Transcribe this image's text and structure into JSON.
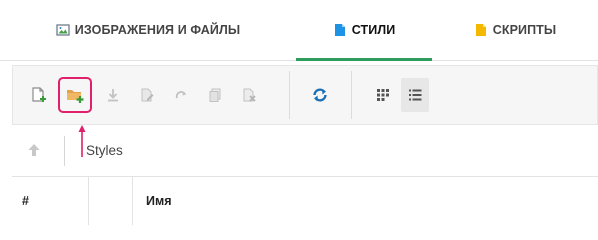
{
  "tabs": [
    {
      "label": "ИЗОБРАЖЕНИЯ И ФАЙЛЫ",
      "icon": "image-icon",
      "active": false
    },
    {
      "label": "СТИЛИ",
      "icon": "blue-document-icon",
      "active": true
    },
    {
      "label": "СКРИПТЫ",
      "icon": "yellow-document-icon",
      "active": false
    }
  ],
  "toolbar": {
    "buttons": [
      {
        "name": "new-file-button",
        "icon": "new-file-icon"
      },
      {
        "name": "new-folder-button",
        "icon": "new-folder-icon",
        "highlighted": true
      },
      {
        "name": "download-button",
        "icon": "download-icon"
      },
      {
        "name": "edit-button",
        "icon": "edit-icon"
      },
      {
        "name": "redo-button",
        "icon": "redo-icon"
      },
      {
        "name": "copy-button",
        "icon": "copy-icon"
      },
      {
        "name": "delete-button",
        "icon": "delete-icon"
      },
      {
        "name": "refresh-button",
        "icon": "refresh-icon"
      },
      {
        "name": "grid-view-button",
        "icon": "grid-view-icon"
      },
      {
        "name": "list-view-button",
        "icon": "list-view-icon",
        "active": true
      }
    ]
  },
  "path": {
    "current": "Styles"
  },
  "table": {
    "columns": [
      "#",
      "",
      "Имя"
    ]
  },
  "colors": {
    "accent_green": "#2e9c5a",
    "highlight_pink": "#e0206a",
    "refresh_blue": "#1a6fb5"
  }
}
